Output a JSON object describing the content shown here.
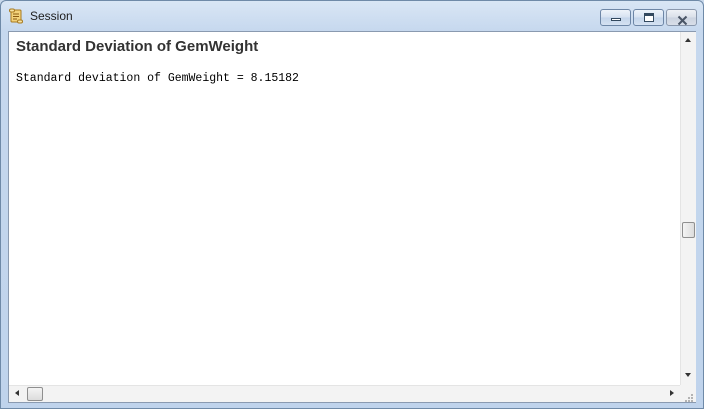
{
  "window": {
    "title": "Session",
    "icon": "session-scroll-icon",
    "controls": {
      "minimize": "minimize-icon",
      "maximize": "maximize-icon",
      "close": "close-icon"
    }
  },
  "content": {
    "heading": "Standard Deviation of GemWeight",
    "output_line": "Standard deviation of GemWeight = 8.15182"
  },
  "scrollbars": {
    "vertical_position": 0.57,
    "horizontal_position": 0.0
  },
  "colors": {
    "title_bar": "#c6d8ee",
    "heading_text": "#333333",
    "output_text": "#000000",
    "client_background": "#ffffff"
  }
}
